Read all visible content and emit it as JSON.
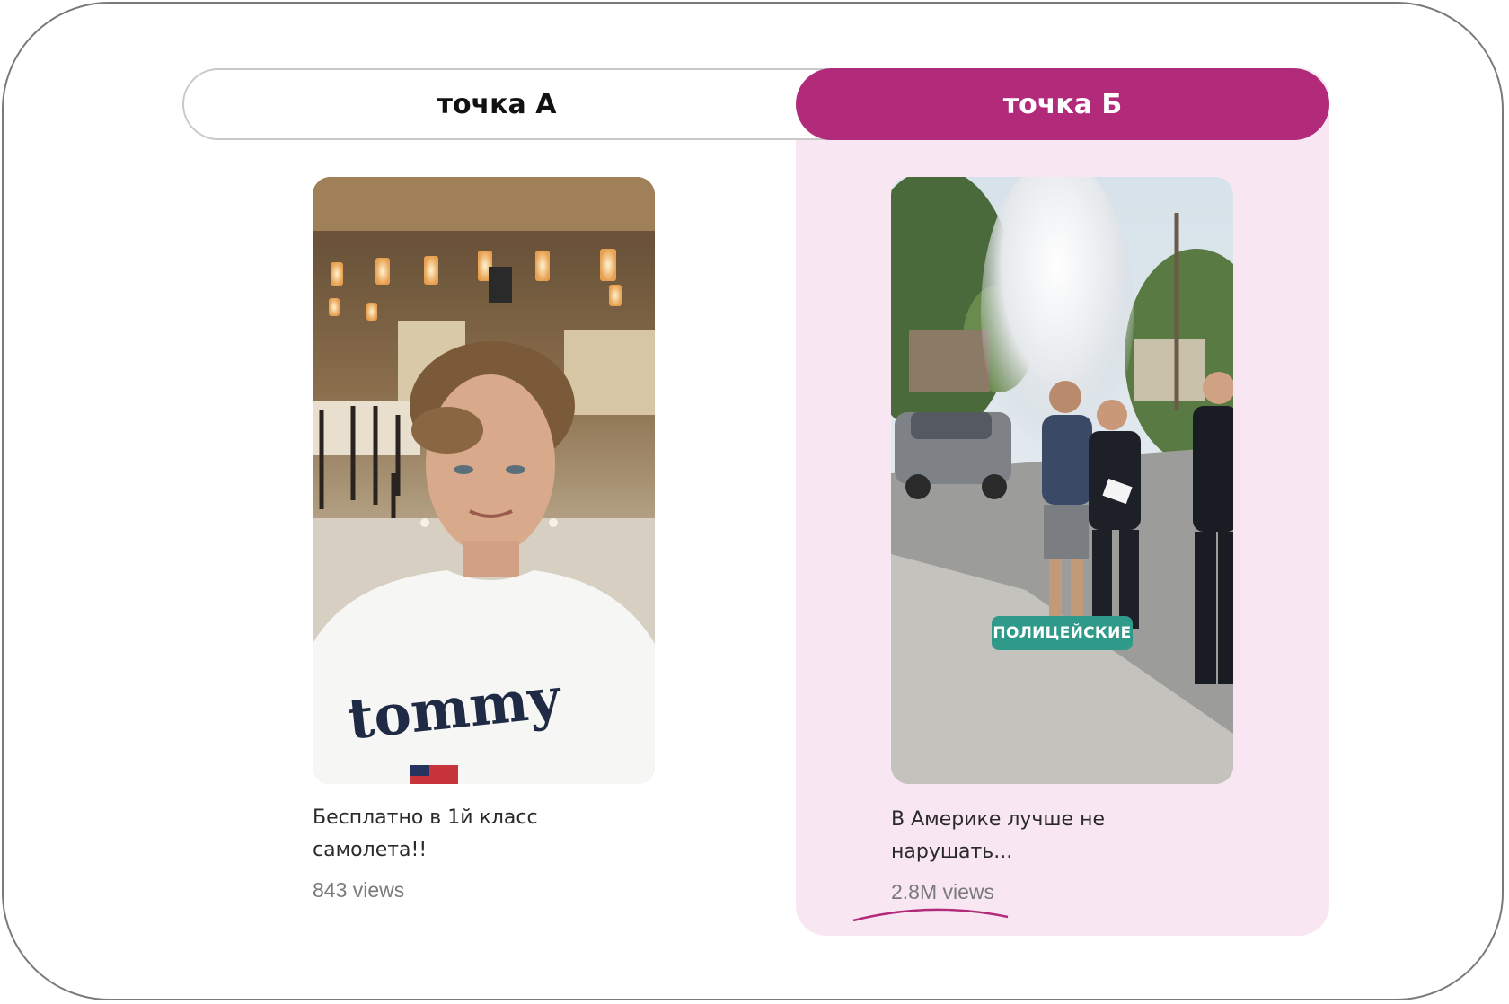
{
  "toggle": {
    "point_a_label": "точка А",
    "point_b_label": "точка Б",
    "active": "point_b"
  },
  "videos": [
    {
      "caption_line1": "Бесплатно в 1й класс",
      "caption_line2": "самолета!!",
      "views": "843 views",
      "shirt_text": "tommy"
    },
    {
      "caption_line1": "В Америке лучше не",
      "caption_line2": "нарушать...",
      "views": "2.8M views",
      "overlay_tag": "ПОЛИЦЕЙСКИЕ"
    }
  ],
  "colors": {
    "accent": "#b22a7a",
    "panel_highlight": "#f8e7f2",
    "tag_bg": "#2f9a8a"
  }
}
